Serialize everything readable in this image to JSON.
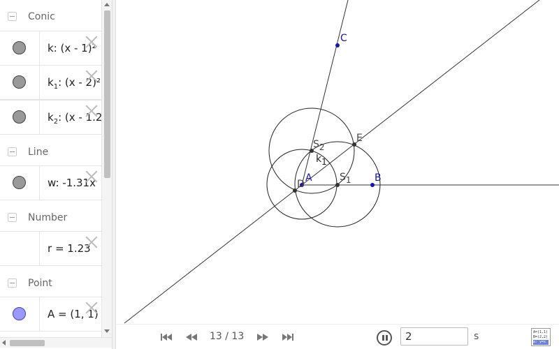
{
  "algebra": {
    "categories": [
      {
        "label": "Conic"
      },
      {
        "label": "Line"
      },
      {
        "label": "Number"
      },
      {
        "label": "Point"
      }
    ],
    "items": [
      {
        "name": "k",
        "expr": ": (x - 1)²"
      },
      {
        "name": "k",
        "sub": "1",
        "expr": ": (x - 2)²"
      },
      {
        "name": "k",
        "sub": "2",
        "expr": ": (x - 1.2"
      },
      {
        "name": "w",
        "expr": ": -1.31x"
      },
      {
        "name": "r",
        "expr": " = 1.23"
      },
      {
        "name": "A",
        "expr": " = (1, 1)"
      }
    ]
  },
  "graphics": {
    "points": {
      "C": "C",
      "E": "E",
      "S2": "S",
      "S2sub": "2",
      "k1": "k",
      "k1sub": "1",
      "A": "A",
      "D": "D",
      "S1": "S",
      "S1sub": "1",
      "B": "B"
    },
    "colors": {
      "blue_point": "#1515aa",
      "line": "#333333"
    }
  },
  "playbar": {
    "step": "13 / 13",
    "speed_value": "2",
    "speed_unit": "s",
    "icons": [
      "first-step-icon",
      "previous-step-icon",
      "next-step-icon",
      "last-step-icon",
      "pause-icon",
      "algebra-description-icon"
    ]
  },
  "alg_icon": {
    "line1": "A=(1,1)",
    "line2": "B=(2,2)",
    "line3": "a: y=x"
  }
}
